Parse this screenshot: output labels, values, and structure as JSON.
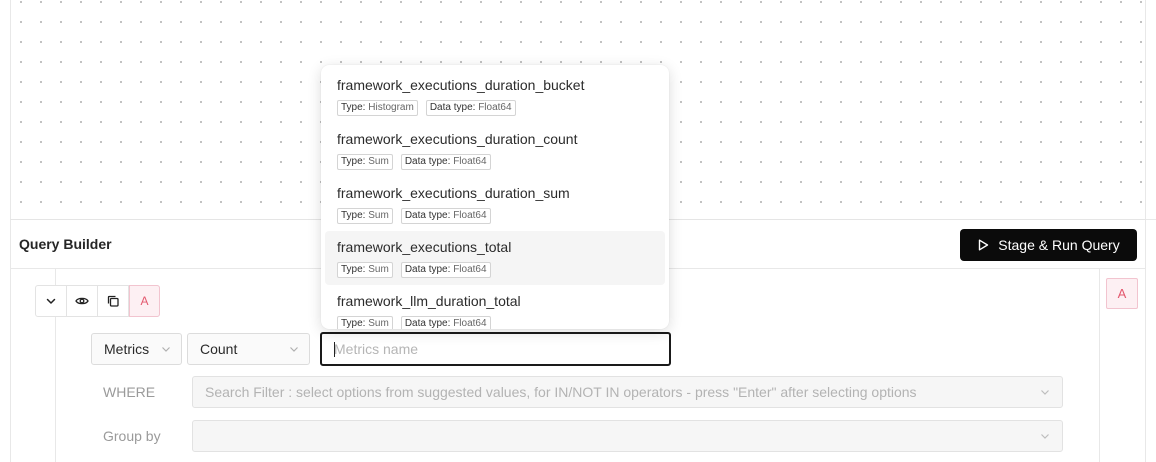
{
  "query_builder": {
    "title": "Query Builder",
    "run_button_label": "Stage & Run Query",
    "query_label": "A"
  },
  "query": {
    "aggregate_type": "Metrics",
    "aggregate_operator": "Count",
    "metric_placeholder": "Metrics name",
    "where_label": "WHERE",
    "where_placeholder": "Search Filter : select options from suggested values, for IN/NOT IN operators - press \"Enter\" after selecting options",
    "group_by_label": "Group by",
    "group_by_value": ""
  },
  "dropdown": {
    "type_key": "Type:",
    "data_type_key": "Data type:",
    "items": [
      {
        "name": "framework_executions_duration_bucket",
        "type": "Histogram",
        "data_type": "Float64",
        "active": false
      },
      {
        "name": "framework_executions_duration_count",
        "type": "Sum",
        "data_type": "Float64",
        "active": false
      },
      {
        "name": "framework_executions_duration_sum",
        "type": "Sum",
        "data_type": "Float64",
        "active": false
      },
      {
        "name": "framework_executions_total",
        "type": "Sum",
        "data_type": "Float64",
        "active": true
      },
      {
        "name": "framework_llm_duration_total",
        "type": "Sum",
        "data_type": "Float64",
        "active": false
      }
    ]
  },
  "colors": {
    "run_button_bg": "#0b0b0b",
    "query_label_accent": "#e3586e",
    "active_item_bg": "#f5f5f5"
  }
}
